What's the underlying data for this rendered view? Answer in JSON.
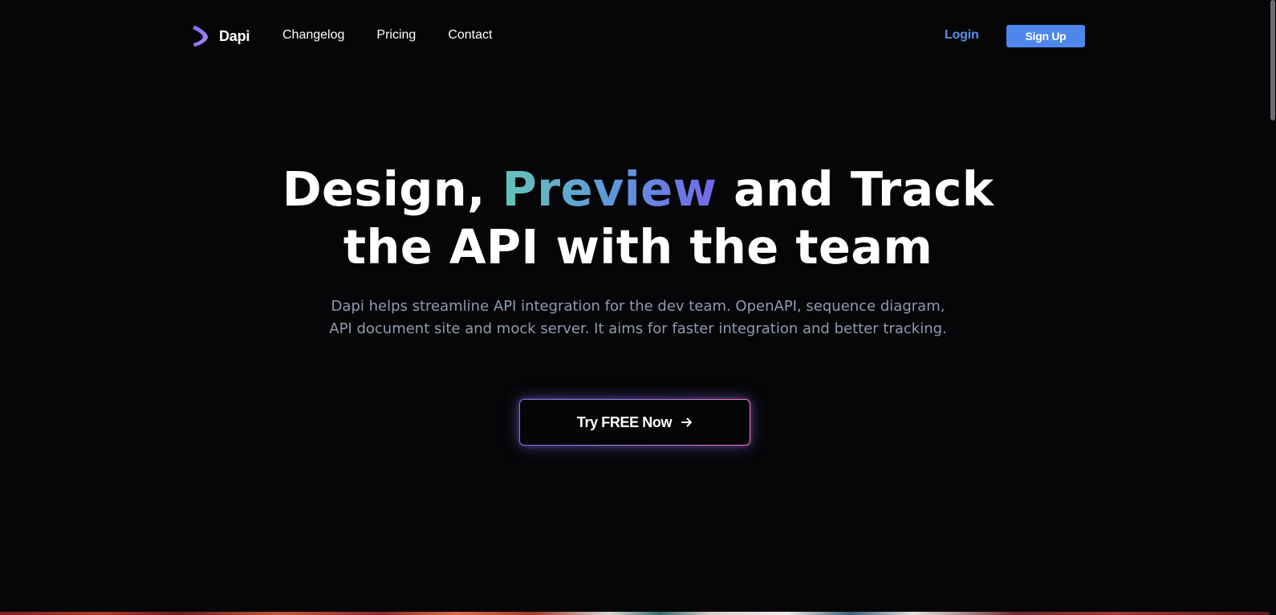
{
  "brand": {
    "name": "Dapi",
    "logo_icon": "dapi-chevron-logo-icon",
    "logo_color": "#9b7ff0"
  },
  "nav": {
    "links": [
      {
        "label": "Changelog"
      },
      {
        "label": "Pricing"
      },
      {
        "label": "Contact"
      }
    ],
    "login_label": "Login",
    "signup_label": "Sign Up"
  },
  "hero": {
    "title_part1": "Design, ",
    "title_highlight": "Preview",
    "title_part2": " and Track",
    "title_line2": "the API with the team",
    "subtitle_line1": "Dapi helps streamline API integration for the dev team. OpenAPI, sequence diagram,",
    "subtitle_line2": "API document site and mock server. It aims for faster integration and better tracking."
  },
  "cta": {
    "label": "Try FREE Now",
    "icon": "arrow-right-icon"
  },
  "colors": {
    "background": "#060608",
    "accent_blue": "#4f86ec",
    "login_blue": "#5b8def",
    "subtitle_gray": "#8f9bb0",
    "gradient_start": "#66c4b7",
    "gradient_mid": "#5f99d8",
    "gradient_end": "#7367ea",
    "cta_glow_pink": "#ee79b8"
  }
}
